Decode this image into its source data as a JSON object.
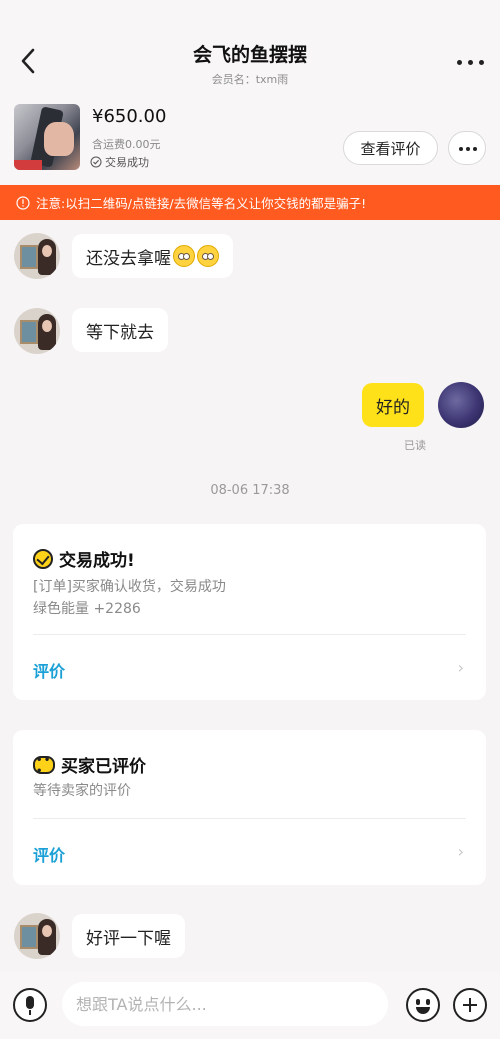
{
  "header": {
    "title": "会飞的鱼摆摆",
    "subtitle": "会员名：txm雨"
  },
  "product": {
    "price": "¥650.00",
    "shipping": "含运费0.00元",
    "status": "交易成功",
    "view_review_label": "查看评价"
  },
  "warning": {
    "text": "注意:以扫二维码/点链接/去微信等名义让你交钱的都是骗子!"
  },
  "messages": [
    {
      "from": "other",
      "text": "还没去拿喔"
    },
    {
      "from": "other",
      "text": "等下就去"
    },
    {
      "from": "me",
      "text": "好的",
      "read_status": "已读"
    }
  ],
  "timestamp": "08-06 17:38",
  "cards": [
    {
      "icon": "check-circle-icon",
      "title": "交易成功!",
      "lines": [
        "[订单]买家确认收货，交易成功",
        "绿色能量 +2286"
      ],
      "action": "评价"
    },
    {
      "icon": "chat-bubble-icon",
      "title": "买家已评价",
      "lines": [
        "等待卖家的评价"
      ],
      "action": "评价"
    }
  ],
  "last_message": {
    "from": "other",
    "text": "好评一下喔"
  },
  "input": {
    "placeholder": "想跟TA说点什么..."
  },
  "colors": {
    "warning_bg": "#ff5a1f",
    "my_bubble": "#ffe11a",
    "link": "#1aa0d6"
  }
}
